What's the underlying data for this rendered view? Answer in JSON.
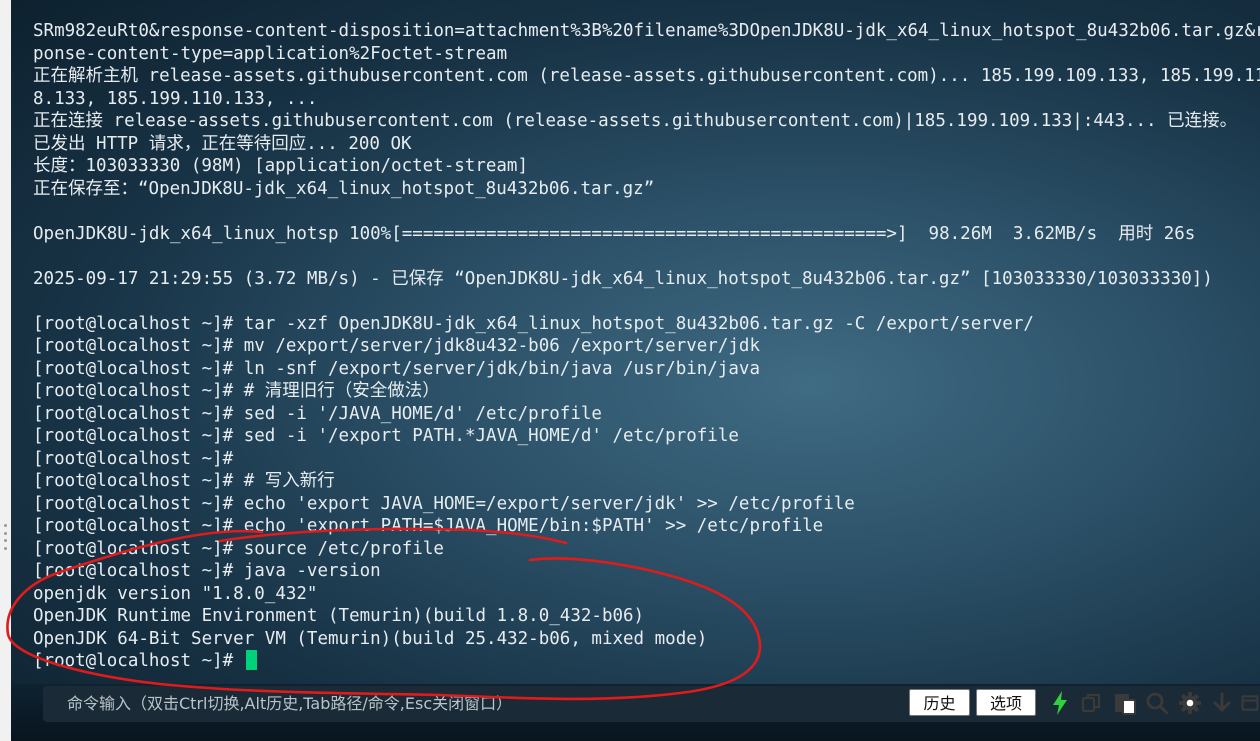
{
  "terminal": {
    "lines": [
      "SRm982euRt0&response-content-disposition=attachment%3B%20filename%3DOpenJDK8U-jdk_x64_linux_hotspot_8u432b06.tar.gz&re",
      "ponse-content-type=application%2Foctet-stream",
      "正在解析主机 release-assets.githubusercontent.com (release-assets.githubusercontent.com)... 185.199.109.133, 185.199.11",
      "8.133, 185.199.110.133, ...",
      "正在连接 release-assets.githubusercontent.com (release-assets.githubusercontent.com)|185.199.109.133|:443... 已连接。",
      "已发出 HTTP 请求，正在等待回应... 200 OK",
      "长度：103033330 (98M) [application/octet-stream]",
      "正在保存至：“OpenJDK8U-jdk_x64_linux_hotspot_8u432b06.tar.gz”",
      "",
      "OpenJDK8U-jdk_x64_linux_hotsp 100%[==============================================>]  98.26M  3.62MB/s  用时 26s",
      "",
      "2025-09-17 21:29:55 (3.72 MB/s) - 已保存 “OpenJDK8U-jdk_x64_linux_hotspot_8u432b06.tar.gz” [103033330/103033330])",
      "",
      "[root@localhost ~]# tar -xzf OpenJDK8U-jdk_x64_linux_hotspot_8u432b06.tar.gz -C /export/server/",
      "[root@localhost ~]# mv /export/server/jdk8u432-b06 /export/server/jdk",
      "[root@localhost ~]# ln -snf /export/server/jdk/bin/java /usr/bin/java",
      "[root@localhost ~]# # 清理旧行（安全做法）",
      "[root@localhost ~]# sed -i '/JAVA_HOME/d' /etc/profile",
      "[root@localhost ~]# sed -i '/export PATH.*JAVA_HOME/d' /etc/profile",
      "[root@localhost ~]#",
      "[root@localhost ~]# # 写入新行",
      "[root@localhost ~]# echo 'export JAVA_HOME=/export/server/jdk' >> /etc/profile",
      "[root@localhost ~]# echo 'export PATH=$JAVA_HOME/bin:$PATH' >> /etc/profile",
      "[root@localhost ~]# source /etc/profile",
      "[root@localhost ~]# java -version",
      "openjdk version \"1.8.0_432\"",
      "OpenJDK Runtime Environment (Temurin)(build 1.8.0_432-b06)",
      "OpenJDK 64-Bit Server VM (Temurin)(build 25.432-b06, mixed mode)"
    ],
    "prompt": "[root@localhost ~]# "
  },
  "cmdbar": {
    "placeholder": "命令输入（双击Ctrl切换,Alt历史,Tab路径/命令,Esc关闭窗口）",
    "history_label": "历史",
    "options_label": "选项"
  },
  "toolbar_icons": [
    "lightning-icon",
    "copy-icon",
    "paste-icon",
    "search-icon",
    "gear-icon",
    "download-icon",
    "window-icon"
  ],
  "colors": {
    "cursor": "#00d27a",
    "lightning": "#2fd13c",
    "annotation": "#e01b1b",
    "text": "#e6ecf0"
  }
}
